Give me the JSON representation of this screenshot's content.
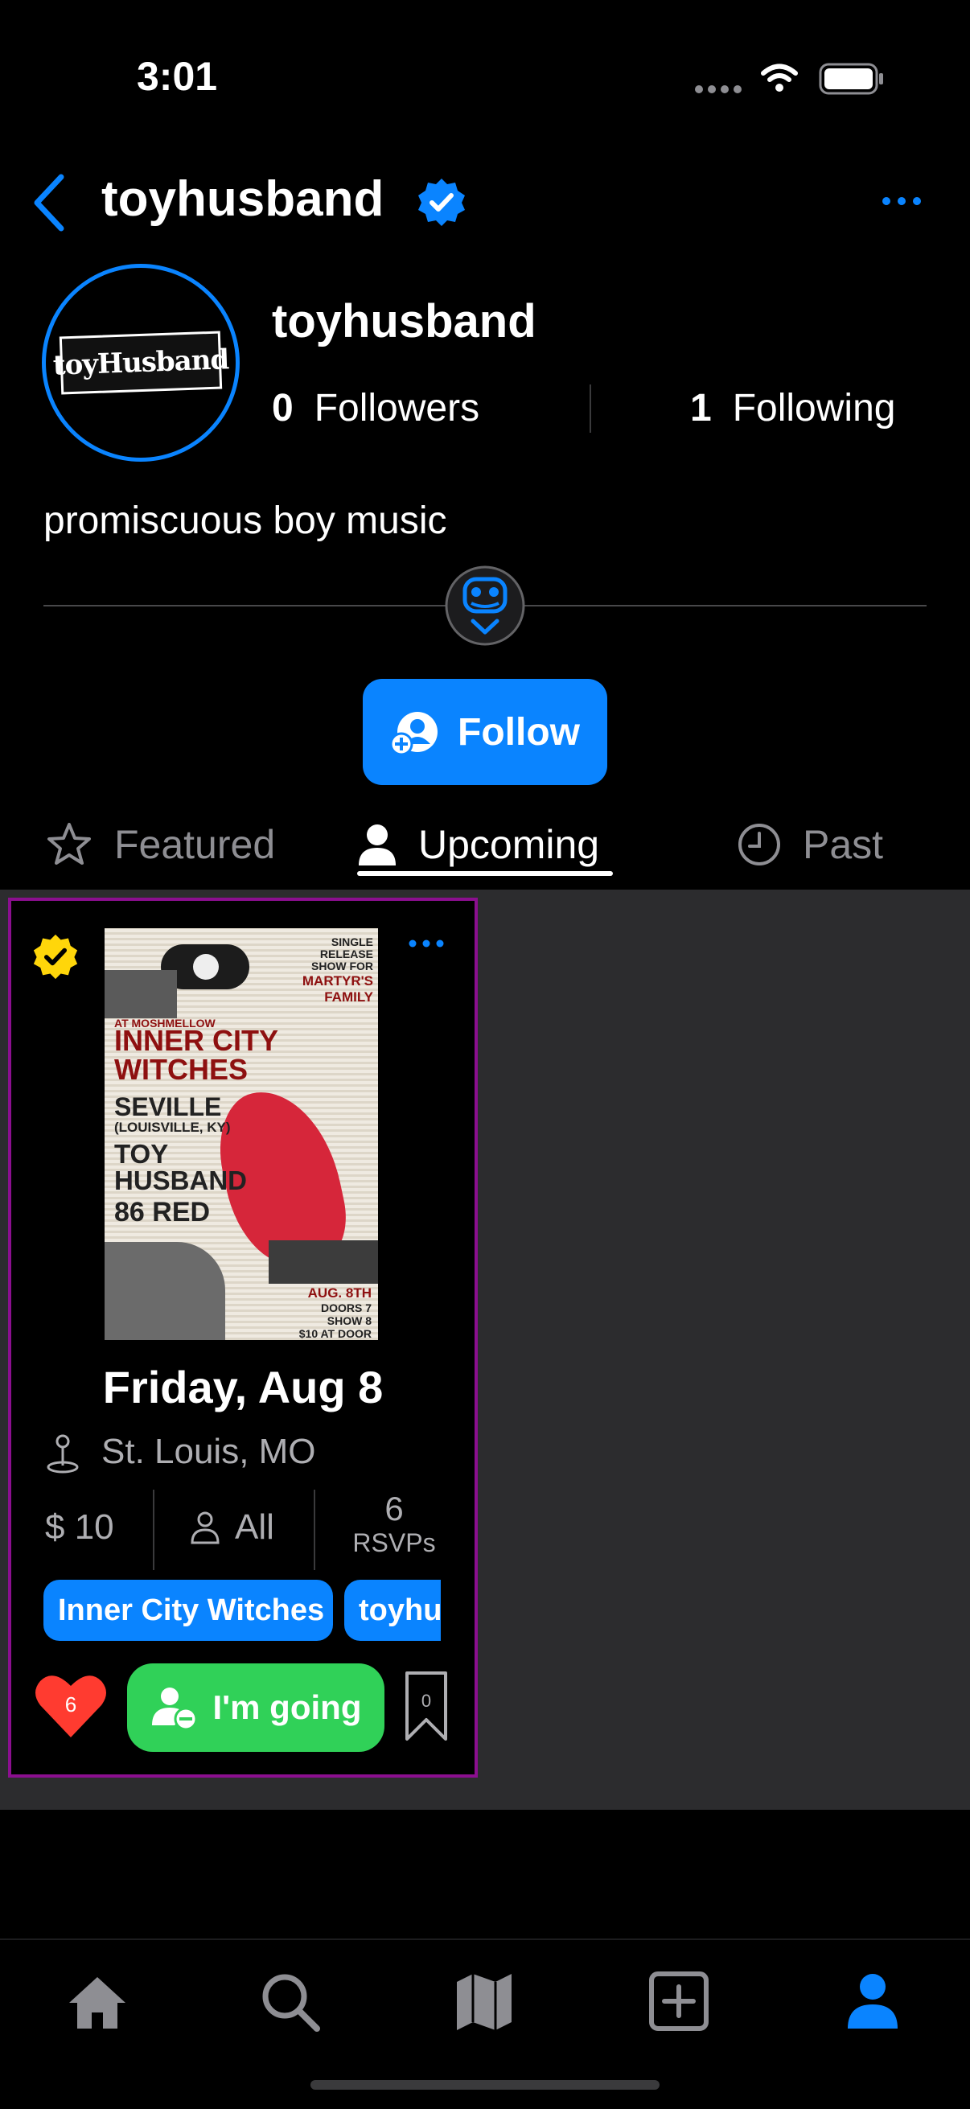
{
  "status_bar": {
    "time": "3:01"
  },
  "top_bar": {
    "title": "toyhusband"
  },
  "profile": {
    "avatar_text": "toyHusband",
    "name": "toyhusband",
    "followers_count": "0",
    "followers_label": "Followers",
    "following_count": "1",
    "following_label": "Following",
    "bio": "promiscuous boy music"
  },
  "follow_button": {
    "label": "Follow"
  },
  "tabs": [
    {
      "label": "Featured",
      "icon": "star-icon"
    },
    {
      "label": "Upcoming",
      "icon": "person-icon",
      "active": true
    },
    {
      "label": "Past",
      "icon": "clock-icon"
    }
  ],
  "event_card": {
    "poster": {
      "top_label": "SINGLE RELEASE SHOW FOR",
      "band_top": "MARTYR'S FAMILY",
      "venue": "AT MOSHMELLOW",
      "headliner": "INNER CITY WITCHES",
      "act2": "SEVILLE",
      "act2_note": "(LOUISVILLE, KY)",
      "act3": "TOY HUSBAND",
      "act4": "86 RED",
      "date": "AUG. 8TH",
      "doors": "DOORS 7",
      "show": "SHOW 8",
      "price": "$10 AT DOOR"
    },
    "date": "Friday, Aug 8",
    "location": "St. Louis, MO",
    "price": "$ 10",
    "age": "All",
    "rsvp_count": "6",
    "rsvp_label": "RSVPs",
    "tags": [
      "Inner City Witches",
      "toyhusband"
    ],
    "likes": "6",
    "going_label": "I'm going",
    "bookmarks": "0"
  },
  "tab_bar": {
    "items": [
      "home-icon",
      "search-icon",
      "map-icon",
      "add-icon",
      "profile-icon"
    ]
  },
  "colors": {
    "accent": "#0a84ff",
    "going": "#30d158",
    "heart": "#ff3b30",
    "card_border": "#8b0f8f",
    "verified_gold": "#ffd60a"
  }
}
